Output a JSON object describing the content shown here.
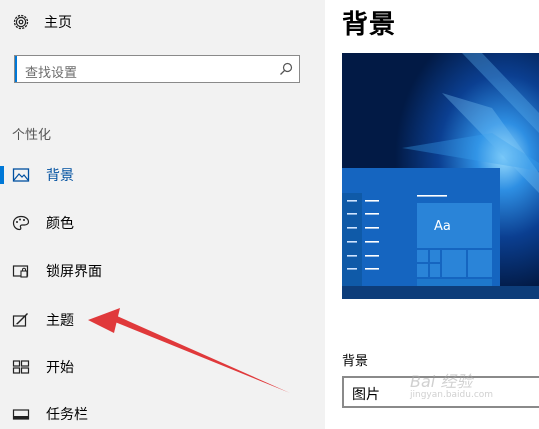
{
  "sidebar": {
    "home_label": "主页",
    "search_placeholder": "查找设置",
    "section_title": "个性化",
    "items": [
      {
        "label": "背景",
        "icon": "picture-icon",
        "selected": true
      },
      {
        "label": "颜色",
        "icon": "palette-icon",
        "selected": false
      },
      {
        "label": "锁屏界面",
        "icon": "lock-screen-icon",
        "selected": false
      },
      {
        "label": "主题",
        "icon": "theme-icon",
        "selected": false
      },
      {
        "label": "开始",
        "icon": "start-tiles-icon",
        "selected": false
      },
      {
        "label": "任务栏",
        "icon": "taskbar-icon",
        "selected": false
      }
    ]
  },
  "main": {
    "title": "背景",
    "preview": {
      "tile_text": "Aa"
    },
    "background_label": "背景",
    "background_value": "图片"
  },
  "watermark": {
    "text": "Bai 经验",
    "sub": "jingyan.baidu.com"
  },
  "colors": {
    "accent": "#0078d7",
    "sidebar_bg": "#f2f2f2",
    "arrow": "#e0393b"
  }
}
